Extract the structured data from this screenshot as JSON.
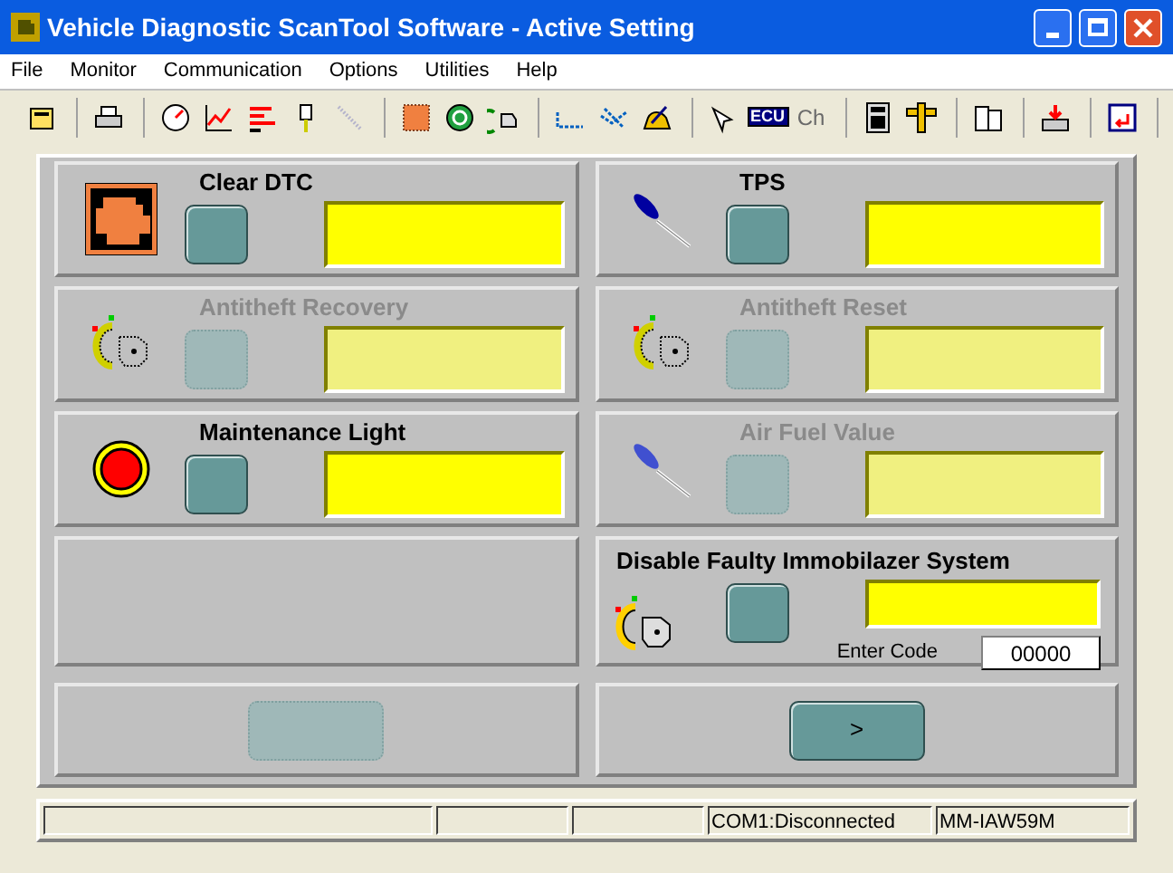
{
  "window": {
    "title": "Vehicle Diagnostic ScanTool Software - Active Setting"
  },
  "menu": [
    {
      "label": "File"
    },
    {
      "label": "Monitor"
    },
    {
      "label": "Communication"
    },
    {
      "label": "Options"
    },
    {
      "label": "Utilities"
    },
    {
      "label": "Help"
    }
  ],
  "toolbar": [
    [
      {
        "disabled": false
      }
    ],
    [
      {
        "disabled": false
      }
    ],
    [
      {
        "disabled": false
      },
      {
        "disabled": false
      },
      {
        "disabled": false
      },
      {
        "disabled": false
      },
      {
        "disabled": true
      }
    ],
    [
      {
        "disabled": false
      },
      {
        "disabled": false
      },
      {
        "disabled": false
      }
    ],
    [
      {
        "disabled": false
      },
      {
        "disabled": false
      },
      {
        "disabled": false
      }
    ],
    [
      {
        "disabled": false
      },
      {
        "disabled": false,
        "label": "ECU"
      },
      {
        "disabled": true,
        "label": "Ch"
      }
    ],
    [
      {
        "disabled": false
      },
      {
        "disabled": false
      }
    ],
    [
      {
        "disabled": false
      }
    ],
    [
      {
        "disabled": false
      }
    ],
    [
      {
        "disabled": false
      }
    ]
  ],
  "panels": [
    {
      "kind": "action",
      "title": "Clear DTC",
      "disabled": false
    },
    {
      "kind": "action",
      "title": "TPS",
      "disabled": false
    },
    {
      "kind": "action",
      "title": "Antitheft Recovery",
      "disabled": true
    },
    {
      "kind": "action",
      "title": "Antitheft Reset",
      "disabled": true
    },
    {
      "kind": "action",
      "title": "Maintenance Light",
      "disabled": false
    },
    {
      "kind": "action",
      "title": "Air Fuel Value",
      "disabled": true
    },
    {
      "kind": "empty"
    },
    {
      "kind": "code",
      "title": "Disable Faulty Immobilazer System",
      "disabled": false,
      "code_label": "Enter Code",
      "code_value": "00000"
    }
  ],
  "nav_buttons": [
    {
      "disabled": true
    },
    {
      "label": ">",
      "disabled": false
    }
  ],
  "status_bar": {
    "panes": [
      "COM1:Disconnected",
      "MM-IAW59M"
    ]
  }
}
